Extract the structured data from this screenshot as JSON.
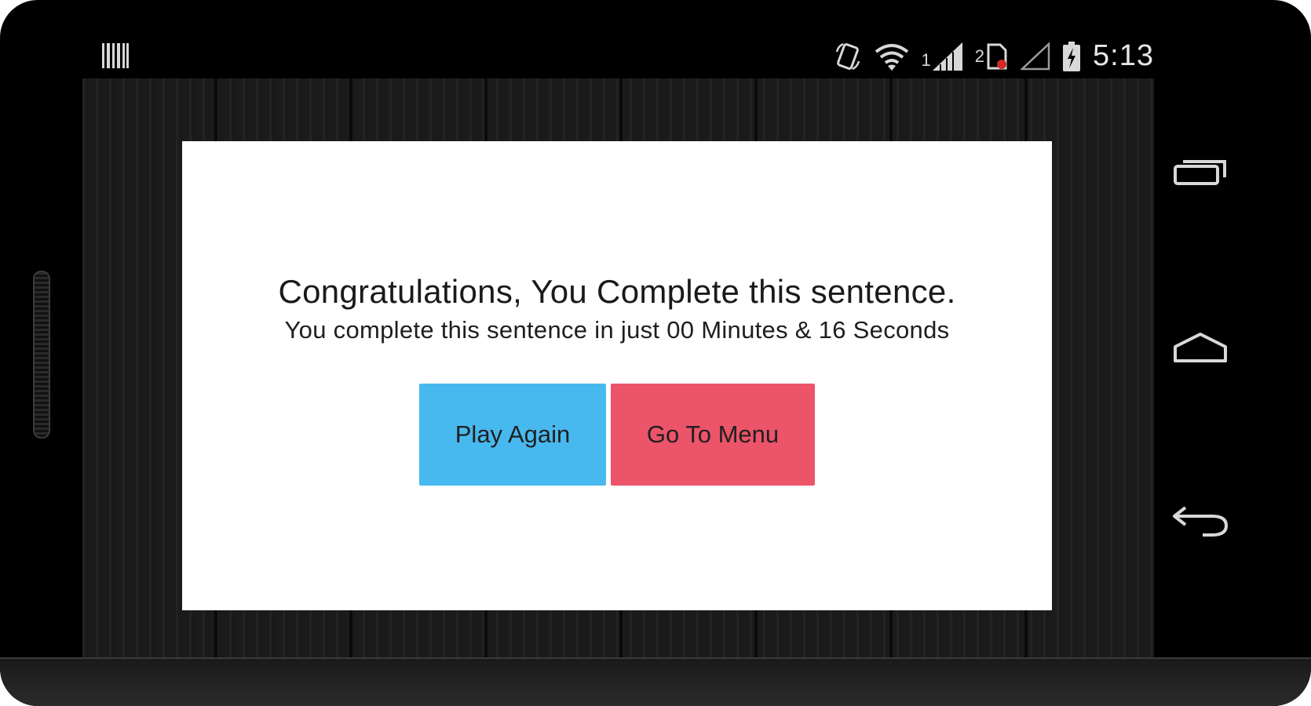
{
  "status_bar": {
    "sim1_label": "1",
    "sim2_label": "2",
    "time": "5:13"
  },
  "dialog": {
    "headline": "Congratulations, You Complete this sentence.",
    "subline": "You complete this sentence in just 00 Minutes & 16 Seconds",
    "play_again_label": "Play Again",
    "go_to_menu_label": "Go To Menu"
  },
  "colors": {
    "play_again": "#48b9ef",
    "go_to_menu": "#ec5469",
    "dialog_bg": "#ffffff"
  },
  "icons": [
    "barcode-icon",
    "rotate-screen-icon",
    "wifi-icon",
    "signal-icon",
    "sim-card-icon",
    "signal-empty-icon",
    "battery-charging-icon",
    "recent-apps-icon",
    "home-icon",
    "back-icon"
  ]
}
